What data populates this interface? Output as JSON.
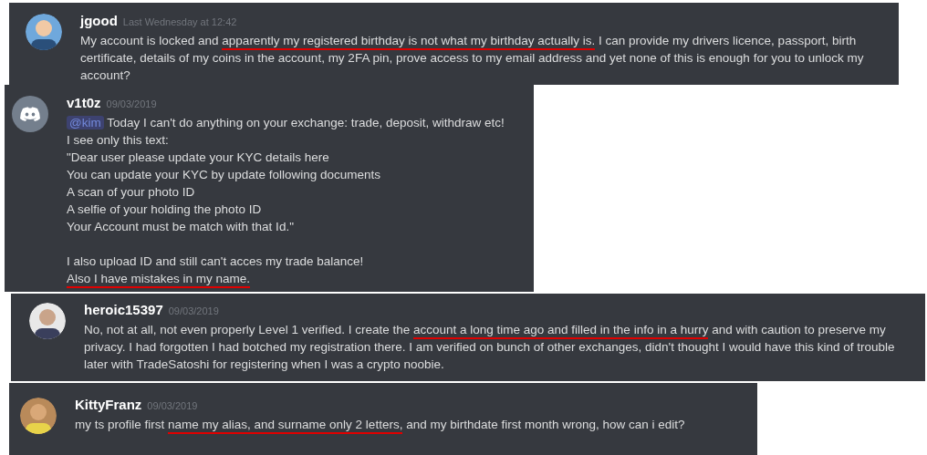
{
  "messages": [
    {
      "username": "jgood",
      "timestamp": "Last Wednesday at 12:42",
      "avatar": {
        "kind": "picture"
      },
      "lines": [
        {
          "segments": [
            {
              "kind": "text",
              "text": "My account is locked and "
            },
            {
              "kind": "underlined",
              "text": "apparently my registered birthday "
            },
            {
              "kind": "underlined",
              "text": "is not what my birthday actually is."
            },
            {
              "kind": "text",
              "text": " I can provide my drivers licence, passport, birth certificate, details of my coins in the account, my 2FA pin, prove access to my email address and yet none of this is enough for you to unlock my account?"
            }
          ]
        }
      ]
    },
    {
      "username": "v1t0z",
      "timestamp": "09/03/2019",
      "avatar": {
        "kind": "logo"
      },
      "lines": [
        {
          "segments": [
            {
              "kind": "mention",
              "text": "@kim"
            },
            {
              "kind": "text",
              "text": " Today I can't do anything on your exchange: trade, deposit, withdraw etc!"
            }
          ]
        },
        {
          "segments": [
            {
              "kind": "text",
              "text": "I see only this text:"
            }
          ]
        },
        {
          "segments": [
            {
              "kind": "text",
              "text": "\"Dear user please update your KYC details here"
            }
          ]
        },
        {
          "segments": [
            {
              "kind": "text",
              "text": "You can update your KYC by update following documents"
            }
          ]
        },
        {
          "segments": [
            {
              "kind": "text",
              "text": "A scan of your photo ID"
            }
          ]
        },
        {
          "segments": [
            {
              "kind": "text",
              "text": "A selfie of your holding the photo ID"
            }
          ]
        },
        {
          "segments": [
            {
              "kind": "text",
              "text": "Your Account must be match with that Id.\""
            }
          ]
        },
        {
          "blank_before": true,
          "segments": [
            {
              "kind": "text",
              "text": "I also upload ID and still can't acces my trade balance!"
            }
          ]
        },
        {
          "segments": [
            {
              "kind": "underlined",
              "text": "Also I have mistakes in my name."
            }
          ]
        }
      ]
    },
    {
      "username": "heroic15397",
      "timestamp": "09/03/2019",
      "avatar": {
        "kind": "picture"
      },
      "lines": [
        {
          "segments": [
            {
              "kind": "text",
              "text": "No, not at all, not even properly Level 1 verified. I create the "
            },
            {
              "kind": "underlined",
              "text": "account a long time ago and filled in the info in a hurry"
            },
            {
              "kind": "text",
              "text": " and with caution to preserve my privacy. I had forgotten I had botched my registration there. I am verified on bunch of other exchanges, didn't thought I would have this kind of trouble later with TradeSatoshi for registering when I was a crypto noobie."
            }
          ]
        }
      ]
    },
    {
      "username": "KittyFranz",
      "timestamp": "09/03/2019",
      "avatar": {
        "kind": "picture"
      },
      "lines": [
        {
          "segments": [
            {
              "kind": "text",
              "text": "my ts profile first "
            },
            {
              "kind": "underlined",
              "text": "name my alias, and surname only 2 letters,"
            },
            {
              "kind": "text",
              "text": "  and my birthdate first month wrong, how can i  edit?"
            }
          ]
        }
      ]
    }
  ]
}
